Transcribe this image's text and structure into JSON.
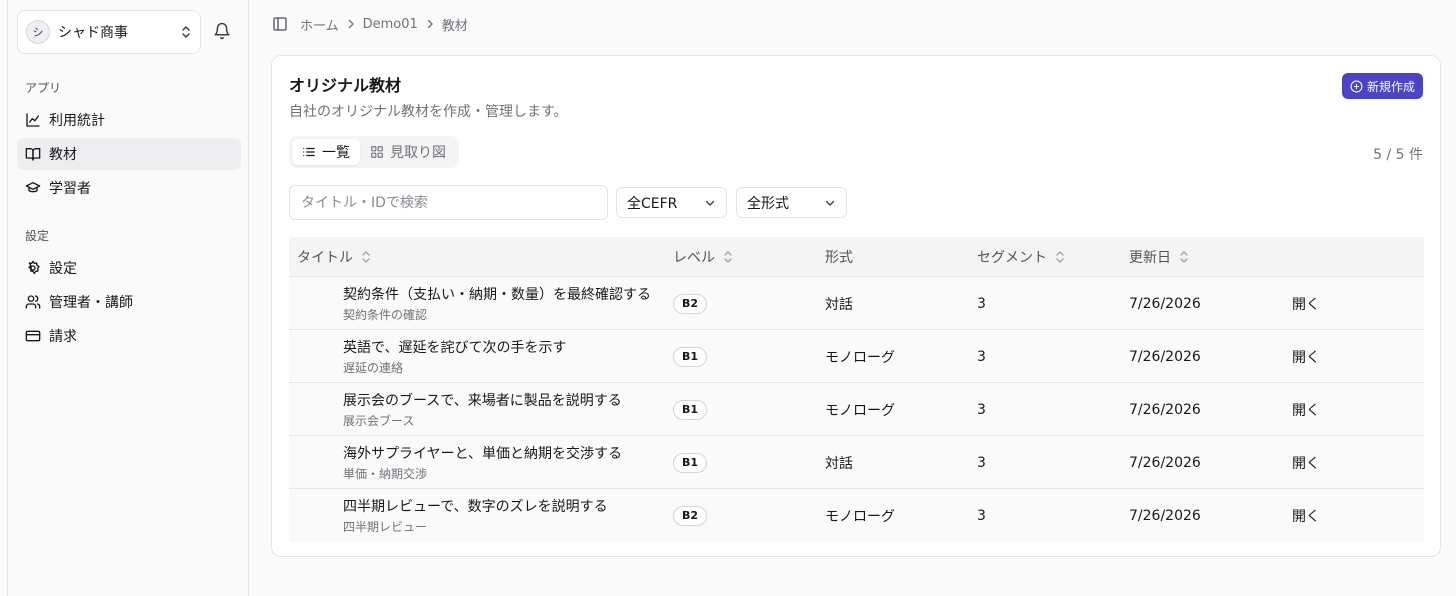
{
  "sidebar": {
    "org": {
      "initial": "シ",
      "name": "シャド商事"
    },
    "groups": [
      {
        "label": "アプリ",
        "items": [
          {
            "label": "利用統計",
            "icon": "chart-line-icon"
          },
          {
            "label": "教材",
            "icon": "book-open-icon",
            "active": true
          },
          {
            "label": "学習者",
            "icon": "graduation-cap-icon"
          }
        ]
      },
      {
        "label": "設定",
        "items": [
          {
            "label": "設定",
            "icon": "gear-icon"
          },
          {
            "label": "管理者・講師",
            "icon": "users-icon"
          },
          {
            "label": "請求",
            "icon": "credit-card-icon"
          }
        ]
      }
    ]
  },
  "breadcrumb": [
    "ホーム",
    "Demo01",
    "教材"
  ],
  "card": {
    "title": "オリジナル教材",
    "description": "自社のオリジナル教材を作成・管理します。",
    "new_button": "新規作成"
  },
  "tabs": [
    {
      "label": "一覧",
      "icon": "list-icon",
      "active": true
    },
    {
      "label": "見取り図",
      "icon": "grid-icon",
      "active": false
    }
  ],
  "count": "5 / 5 件",
  "search": {
    "placeholder": "タイトル・IDで検索",
    "value": ""
  },
  "filters": {
    "cefr": "全CEFR",
    "format": "全形式"
  },
  "table": {
    "columns": [
      "タイトル",
      "レベル",
      "形式",
      "セグメント",
      "更新日"
    ],
    "open_label": "開く",
    "rows": [
      {
        "title": "契約条件（支払い・納期・数量）を最終確認する",
        "subtitle": "契約条件の確認",
        "level": "B2",
        "format": "対話",
        "segments": "3",
        "updated": "7/26/2026"
      },
      {
        "title": "英語で、遅延を詫びて次の手を示す",
        "subtitle": "遅延の連絡",
        "level": "B1",
        "format": "モノローグ",
        "segments": "3",
        "updated": "7/26/2026"
      },
      {
        "title": "展示会のブースで、来場者に製品を説明する",
        "subtitle": "展示会ブース",
        "level": "B1",
        "format": "モノローグ",
        "segments": "3",
        "updated": "7/26/2026"
      },
      {
        "title": "海外サプライヤーと、単価と納期を交渉する",
        "subtitle": "単価・納期交渉",
        "level": "B1",
        "format": "対話",
        "segments": "3",
        "updated": "7/26/2026"
      },
      {
        "title": "四半期レビューで、数字のズレを説明する",
        "subtitle": "四半期レビュー",
        "level": "B2",
        "format": "モノローグ",
        "segments": "3",
        "updated": "7/26/2026"
      }
    ]
  },
  "colors": {
    "primary": "#4c44c6",
    "muted": "#71717a",
    "border": "#e4e4e7"
  }
}
